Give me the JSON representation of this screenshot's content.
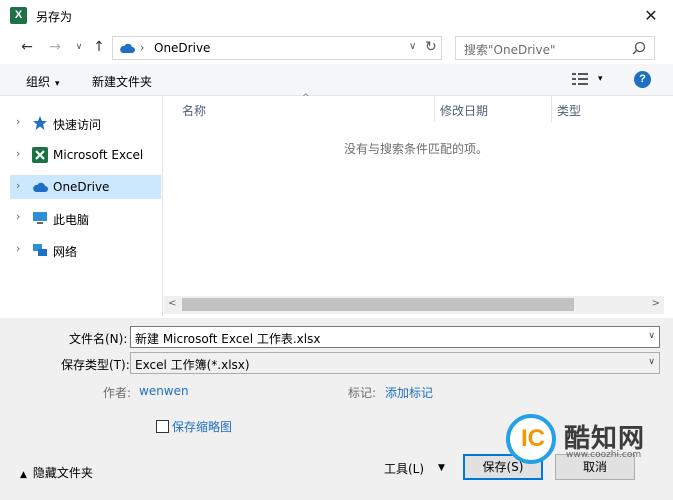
{
  "window": {
    "title": "另存为",
    "close_glyph": "✕",
    "app_icon_letter": "X"
  },
  "nav": {
    "back_glyph": "←",
    "forward_glyph": "→",
    "recent_glyph": "∨",
    "up_glyph": "↑",
    "address_separator": "›",
    "address_location": "OneDrive",
    "address_dropdown_glyph": "∨",
    "refresh_glyph": "↻",
    "search_placeholder": "搜索\"OneDrive\""
  },
  "toolbar": {
    "organize_label": "组织",
    "caret": "▾",
    "new_folder_label": "新建文件夹",
    "help_label": "?"
  },
  "sidebar": {
    "items": [
      {
        "label": "快速访问",
        "icon": "star-icon",
        "selected": false
      },
      {
        "label": "Microsoft Excel",
        "icon": "excel-icon",
        "selected": false
      },
      {
        "label": "OneDrive",
        "icon": "cloud-icon",
        "selected": true
      },
      {
        "label": "此电脑",
        "icon": "computer-icon",
        "selected": false
      },
      {
        "label": "网络",
        "icon": "network-icon",
        "selected": false
      }
    ],
    "chevron": "›"
  },
  "file_list": {
    "sort_caret": "^",
    "columns": [
      "名称",
      "修改日期",
      "类型"
    ],
    "empty_message": "没有与搜索条件匹配的项。"
  },
  "scroll": {
    "left_arrow": "<",
    "right_arrow": ">"
  },
  "form": {
    "filename_label": "文件名(N):",
    "filename_value": "新建 Microsoft Excel 工作表.xlsx",
    "filetype_label": "保存类型(T):",
    "filetype_value": "Excel 工作簿(*.xlsx)",
    "dropdown_caret": "∨",
    "author_label": "作者:",
    "author_value": "wenwen",
    "tags_label": "标记:",
    "tags_value": "添加标记",
    "thumbnail_label": "保存缩略图"
  },
  "footer": {
    "hide_folders_caret": "▲",
    "hide_folders_label": "隐藏文件夹",
    "tools_label": "工具(L)",
    "tools_caret": "▼",
    "save_label": "保存(S)",
    "cancel_label": "取消"
  },
  "watermark": {
    "mark": "IC",
    "brand": "酷知网",
    "url": "www.coozhi.com"
  },
  "colors": {
    "accent": "#0078d7",
    "link": "#1f6fc4",
    "selected_bg": "#cce8ff",
    "excel_green": "#1e7145"
  }
}
